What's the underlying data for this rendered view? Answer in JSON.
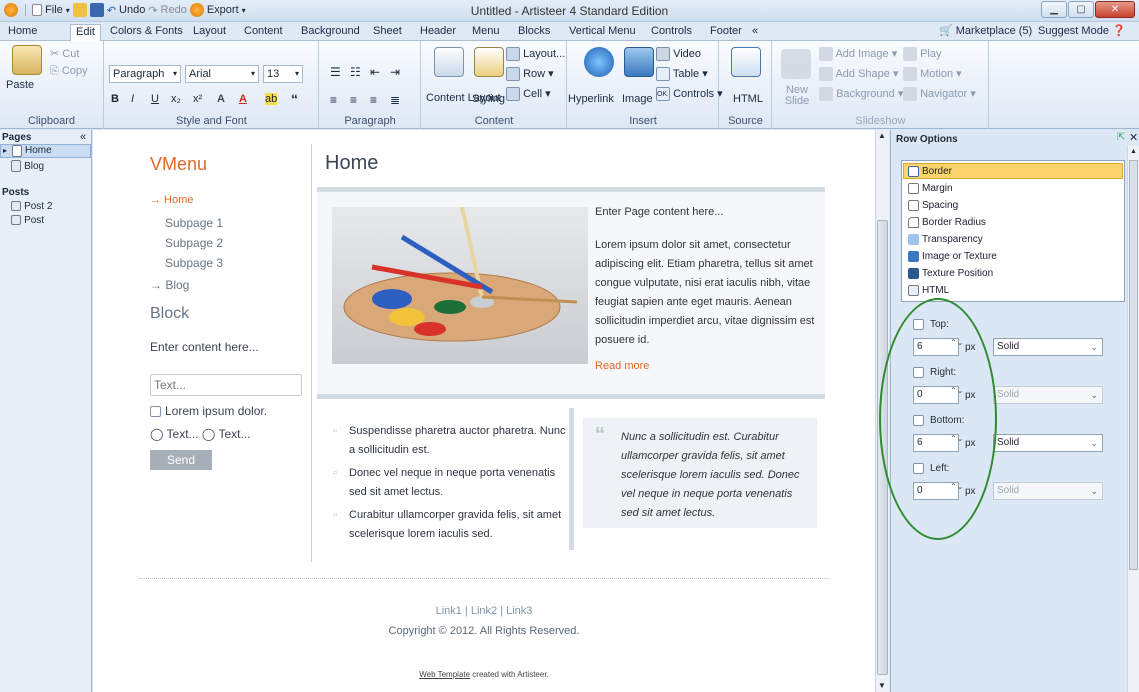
{
  "titlebar": {
    "title": "Untitled - Artisteer 4 Standard Edition",
    "file": "File",
    "undo": "Undo",
    "redo": "Redo",
    "export": "Export",
    "min": "▁",
    "max": "▢",
    "close": "✕"
  },
  "tabs": [
    "Home",
    "Edit",
    "Colors & Fonts",
    "Layout",
    "Content",
    "Background",
    "Sheet",
    "Header",
    "Menu",
    "Blocks",
    "Vertical Menu",
    "Controls",
    "Footer",
    "«"
  ],
  "tabs_right": {
    "marketplace": "Marketplace (5)",
    "suggest": "Suggest Mode"
  },
  "ribbon": {
    "clipboard": {
      "label": "Clipboard",
      "paste": "Paste",
      "cut": "Cut",
      "copy": "Copy"
    },
    "style": {
      "label": "Style and Font",
      "paragraph": "Paragraph",
      "font": "Arial",
      "size": "13",
      "bold": "B",
      "italic": "I",
      "underline": "U",
      "sub": "x₂",
      "sup": "x²",
      "highlight": "A",
      "color": "A",
      "mark": "ab",
      "quote": "“"
    },
    "paragraph": {
      "label": "Paragraph"
    },
    "content": {
      "label": "Content",
      "layout_btn": "Content Layout",
      "styling": "Styling",
      "layout": "Layout...",
      "row": "Row",
      "cell": "Cell"
    },
    "insert": {
      "label": "Insert",
      "hyperlink": "Hyperlink",
      "image": "Image",
      "video": "Video",
      "table": "Table",
      "controls": "Controls"
    },
    "source": {
      "label": "Source",
      "html": "HTML"
    },
    "slideshow": {
      "label": "Slideshow",
      "new_slide": "New Slide",
      "add_image": "Add Image",
      "add_shape": "Add Shape",
      "background": "Background",
      "play": "Play",
      "motion": "Motion",
      "navigator": "Navigator"
    }
  },
  "pages_panel": {
    "header": "Pages",
    "collapse": "«",
    "pages": [
      "Home",
      "Blog"
    ],
    "posts_header": "Posts",
    "posts": [
      "Post 2",
      "Post"
    ]
  },
  "site": {
    "vmenu_title": "VMenu",
    "vmenu": [
      "→ Home",
      "Subpage 1",
      "Subpage 2",
      "Subpage 3",
      "→ Blog"
    ],
    "block_title": "Block",
    "block_text": "Enter content here...",
    "text_placeholder": "Text...",
    "checkbox_label": "Lorem ipsum dolor.",
    "radio1": "Text...",
    "radio2": "Text...",
    "send": "Send",
    "page_title": "Home",
    "intro": "Enter Page content here...",
    "lorem": "Lorem ipsum dolor sit amet, consectetur adipiscing elit. Etiam pharetra, tellus sit amet congue vulputate, nisi erat iaculis nibh, vitae feugiat sapien ante eget mauris. Aenean sollicitudin imperdiet arcu, vitae dignissim est posuere id.",
    "read_more": "Read more",
    "bullets": [
      "Suspendisse pharetra auctor pharetra. Nunc a sollicitudin est.",
      "Donec vel neque in neque porta venenatis sed sit amet lectus.",
      "Curabitur ullamcorper gravida felis, sit amet scelerisque lorem iaculis sed."
    ],
    "quote": "Nunc a sollicitudin est. Curabitur ullamcorper gravida felis, sit amet scelerisque lorem iaculis sed. Donec vel neque in neque porta venenatis sed sit amet lectus.",
    "footer_links": "Link1 | Link2 | Link3",
    "copyright": "Copyright © 2012. All Rights Reserved.",
    "webtemplate": "Web Template",
    "created": "created with Artisteer."
  },
  "row_options": {
    "title": "Row Options",
    "items": [
      "Border",
      "Margin",
      "Spacing",
      "Border Radius",
      "Transparency",
      "Image or Texture",
      "Texture Position",
      "HTML"
    ],
    "top": {
      "label": "Top:",
      "value": "6",
      "unit": "px",
      "style": "Solid"
    },
    "right": {
      "label": "Right:",
      "value": "0",
      "unit": "px",
      "style": "Solid"
    },
    "bottom": {
      "label": "Bottom:",
      "value": "6",
      "unit": "px",
      "style": "Solid"
    },
    "left": {
      "label": "Left:",
      "value": "0",
      "unit": "px",
      "style": "Solid"
    }
  },
  "colors": {
    "accent": "#e2672b",
    "annotation": "#2e8b2e",
    "selected": "#fbd46b"
  }
}
